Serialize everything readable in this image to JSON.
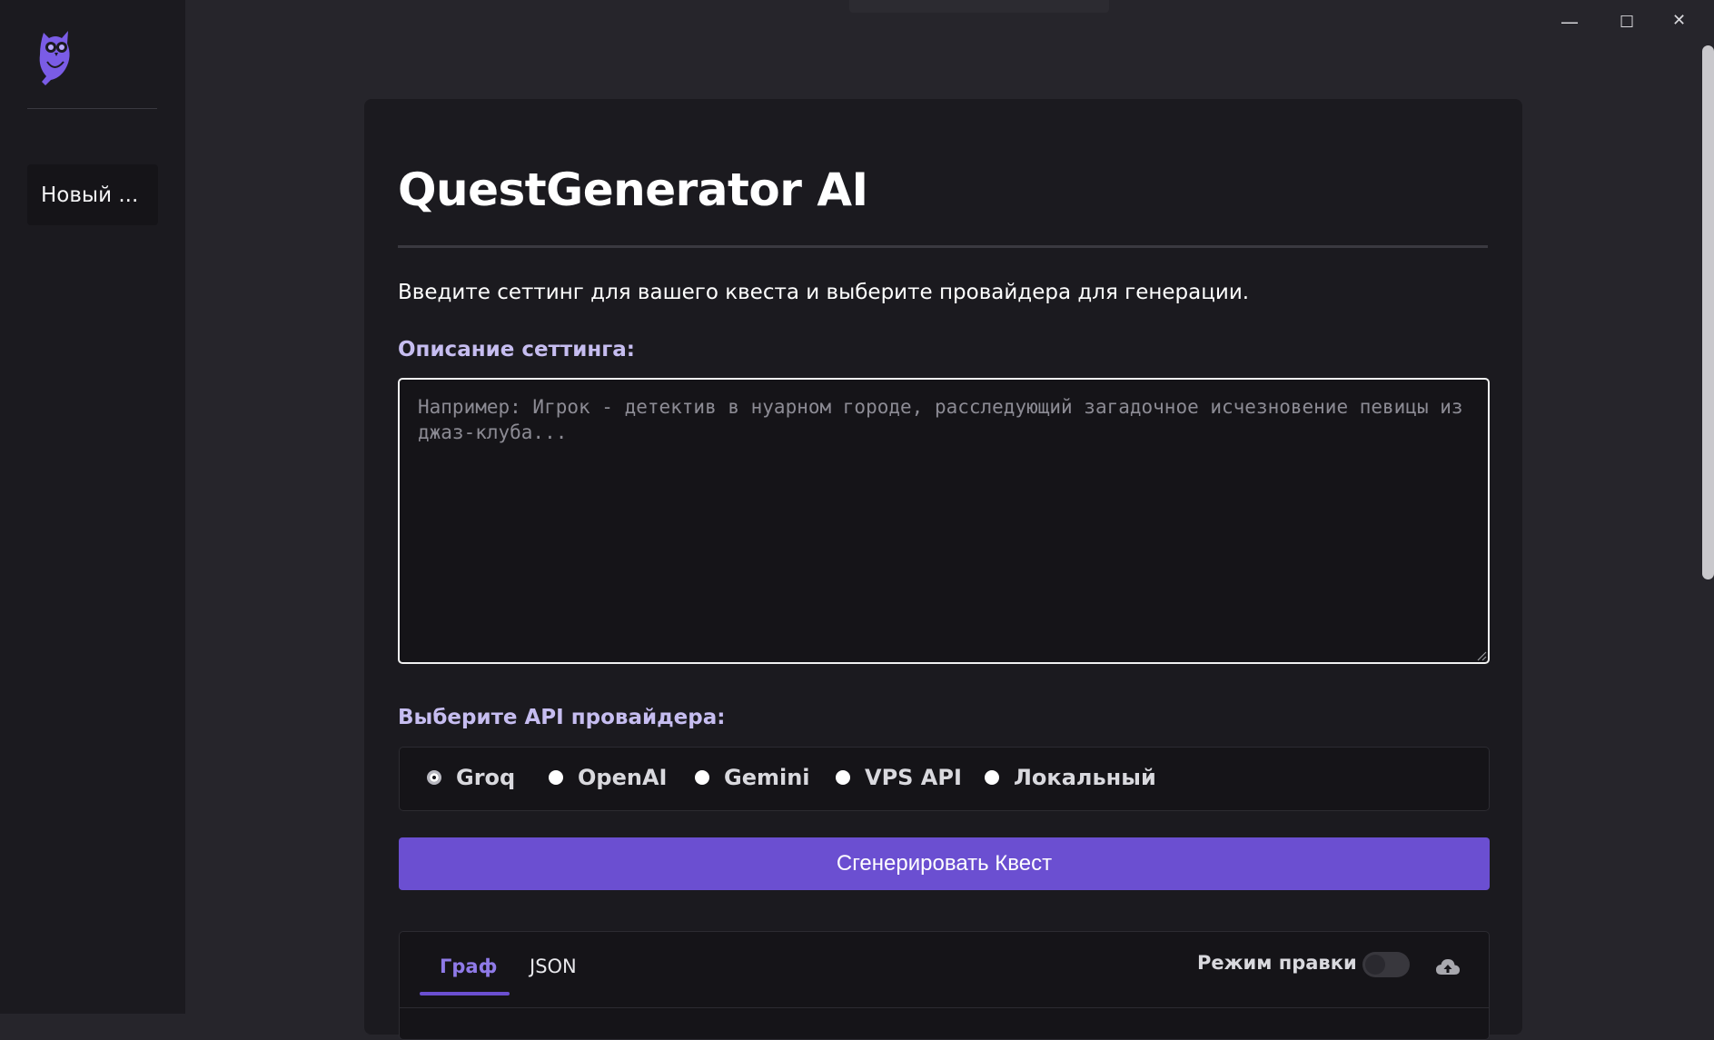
{
  "sidebar": {
    "logo_icon": "owl-logo-icon",
    "items": [
      {
        "label": "Новый ..."
      }
    ]
  },
  "window_controls": {
    "minimize": "—",
    "maximize": "☐",
    "close": "✕"
  },
  "main": {
    "title": "QuestGenerator AI",
    "intro": "Введите сеттинг для вашего квеста и выберите провайдера для генерации.",
    "setting_label": "Описание сеттинга:",
    "setting_placeholder": "Например: Игрок - детектив в нуарном городе, расследующий загадочное исчезновение певицы из джаз-клуба...",
    "setting_value": "",
    "provider_label": "Выберите API провайдера:",
    "providers": [
      {
        "label": "Groq",
        "selected": true
      },
      {
        "label": "OpenAI",
        "selected": false
      },
      {
        "label": "Gemini",
        "selected": false
      },
      {
        "label": "VPS API",
        "selected": false
      },
      {
        "label": "Локальный",
        "selected": false
      }
    ],
    "generate_button": "Сгенерировать Квест",
    "tabs": [
      {
        "label": "Граф",
        "active": true
      },
      {
        "label": "JSON",
        "active": false
      }
    ],
    "edit_mode_label": "Режим правки",
    "edit_mode_on": false,
    "cloud_icon": "cloud-upload-icon"
  },
  "colors": {
    "accent": "#6b4fd1",
    "label": "#c6bdf0",
    "background": "#26252b",
    "card": "#1b1a1f"
  }
}
